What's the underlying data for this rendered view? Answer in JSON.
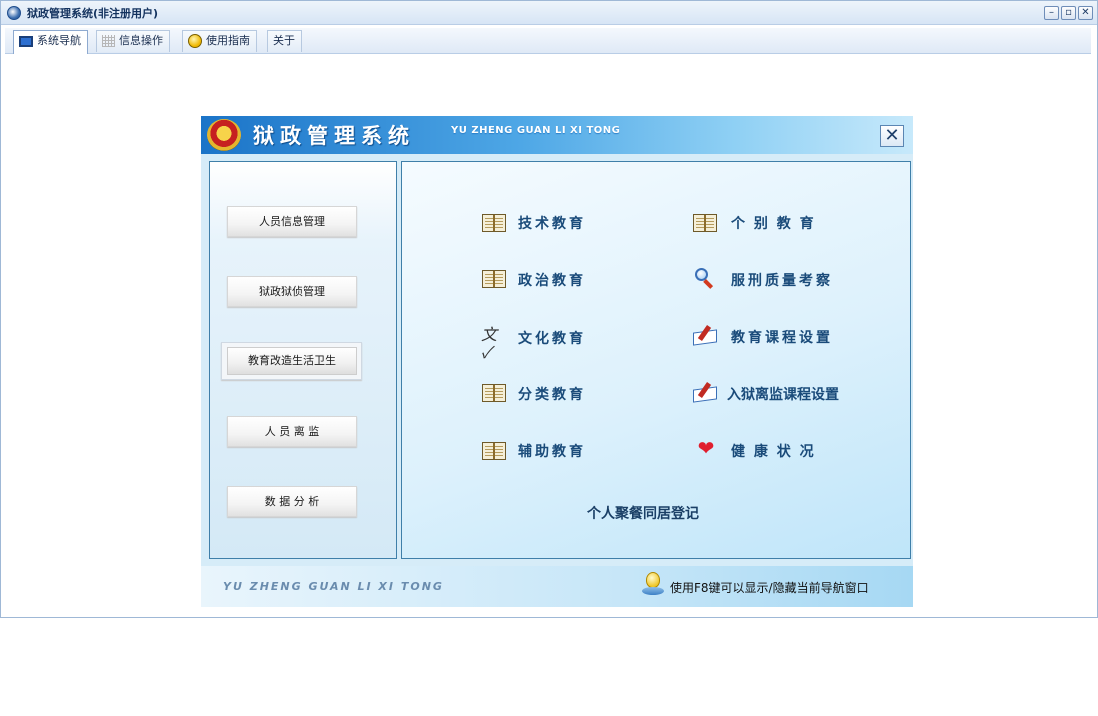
{
  "window": {
    "title": "狱政管理系统(非注册用户)",
    "buttons": {
      "minimize": "–",
      "restore": "▫",
      "close": "✕"
    }
  },
  "tabs": [
    {
      "label": "系统导航",
      "icon": "monitor-icon",
      "active": true
    },
    {
      "label": "信息操作",
      "icon": "grid-icon",
      "active": false
    },
    {
      "label": "使用指南",
      "icon": "bulb-icon",
      "active": false
    },
    {
      "label": "关于",
      "icon": "",
      "active": false
    }
  ],
  "panel": {
    "title": "狱政管理系统",
    "subtitle": "YU ZHENG GUAN LI XI TONG",
    "close": "✕"
  },
  "menu": [
    {
      "label": "人员信息管理"
    },
    {
      "label": "狱政狱侦管理"
    },
    {
      "label": "教育改造生活卫生",
      "selected": true
    },
    {
      "label": "人 员 离 监"
    },
    {
      "label": "数 据 分 析"
    }
  ],
  "education": {
    "left": [
      {
        "label": "技术教育",
        "icon": "book-icon"
      },
      {
        "label": "政治教育",
        "icon": "book-icon"
      },
      {
        "label": "文化教育",
        "icon": "writing-icon"
      },
      {
        "label": "分类教育",
        "icon": "book-icon"
      },
      {
        "label": "辅助教育",
        "icon": "book-icon"
      }
    ],
    "right": [
      {
        "label": "个 别 教 育",
        "icon": "book-icon"
      },
      {
        "label": "服刑质量考察",
        "icon": "magnifier-icon"
      },
      {
        "label": "教育课程设置",
        "icon": "pen-book-icon"
      },
      {
        "label": "入狱离监课程设置",
        "icon": "pen-book-icon"
      },
      {
        "label": "健 康 状 况",
        "icon": "heart-icon"
      }
    ],
    "register": "个人聚餐同居登记"
  },
  "footer": {
    "brand": "YU ZHENG GUAN LI XI TONG",
    "tip": "使用F8键可以显示/隐藏当前导航窗口"
  }
}
